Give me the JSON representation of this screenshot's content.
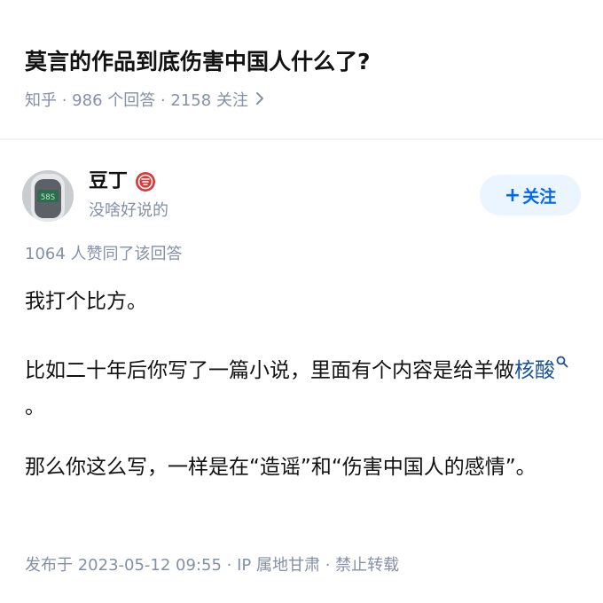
{
  "question": {
    "title": "莫言的作品到底伤害中国人什么了?",
    "meta": "知乎 · 986 个回答 · 2158 关注",
    "chevron_icon": "chevron-right-icon"
  },
  "author": {
    "name": "豆丁",
    "bio": "没啥好说的",
    "avatar_icon": "avatar-thermometer-image",
    "badge_icon": "creator-badge-icon",
    "follow_label": "关注",
    "follow_plus": "+"
  },
  "answer": {
    "votes": "1064 人赞同了该回答",
    "p1": "我打个比方。",
    "p2_before": "比如二十年后你写了一篇小说，里面有个内容是给羊做",
    "p2_link": "核酸",
    "p2_after": "。",
    "p3": "那么你这么写，一样是在“造谣”和“伤害中国人的感情”。",
    "footer": "发布于 2023-05-12 09:55 · IP 属地甘肃 · 禁止转载"
  },
  "colors": {
    "accent": "#0066ff",
    "follow_bg": "#ebf5ff",
    "meta_gray": "#8590a6",
    "link": "#175199",
    "badge_red": "#d93a3a"
  }
}
